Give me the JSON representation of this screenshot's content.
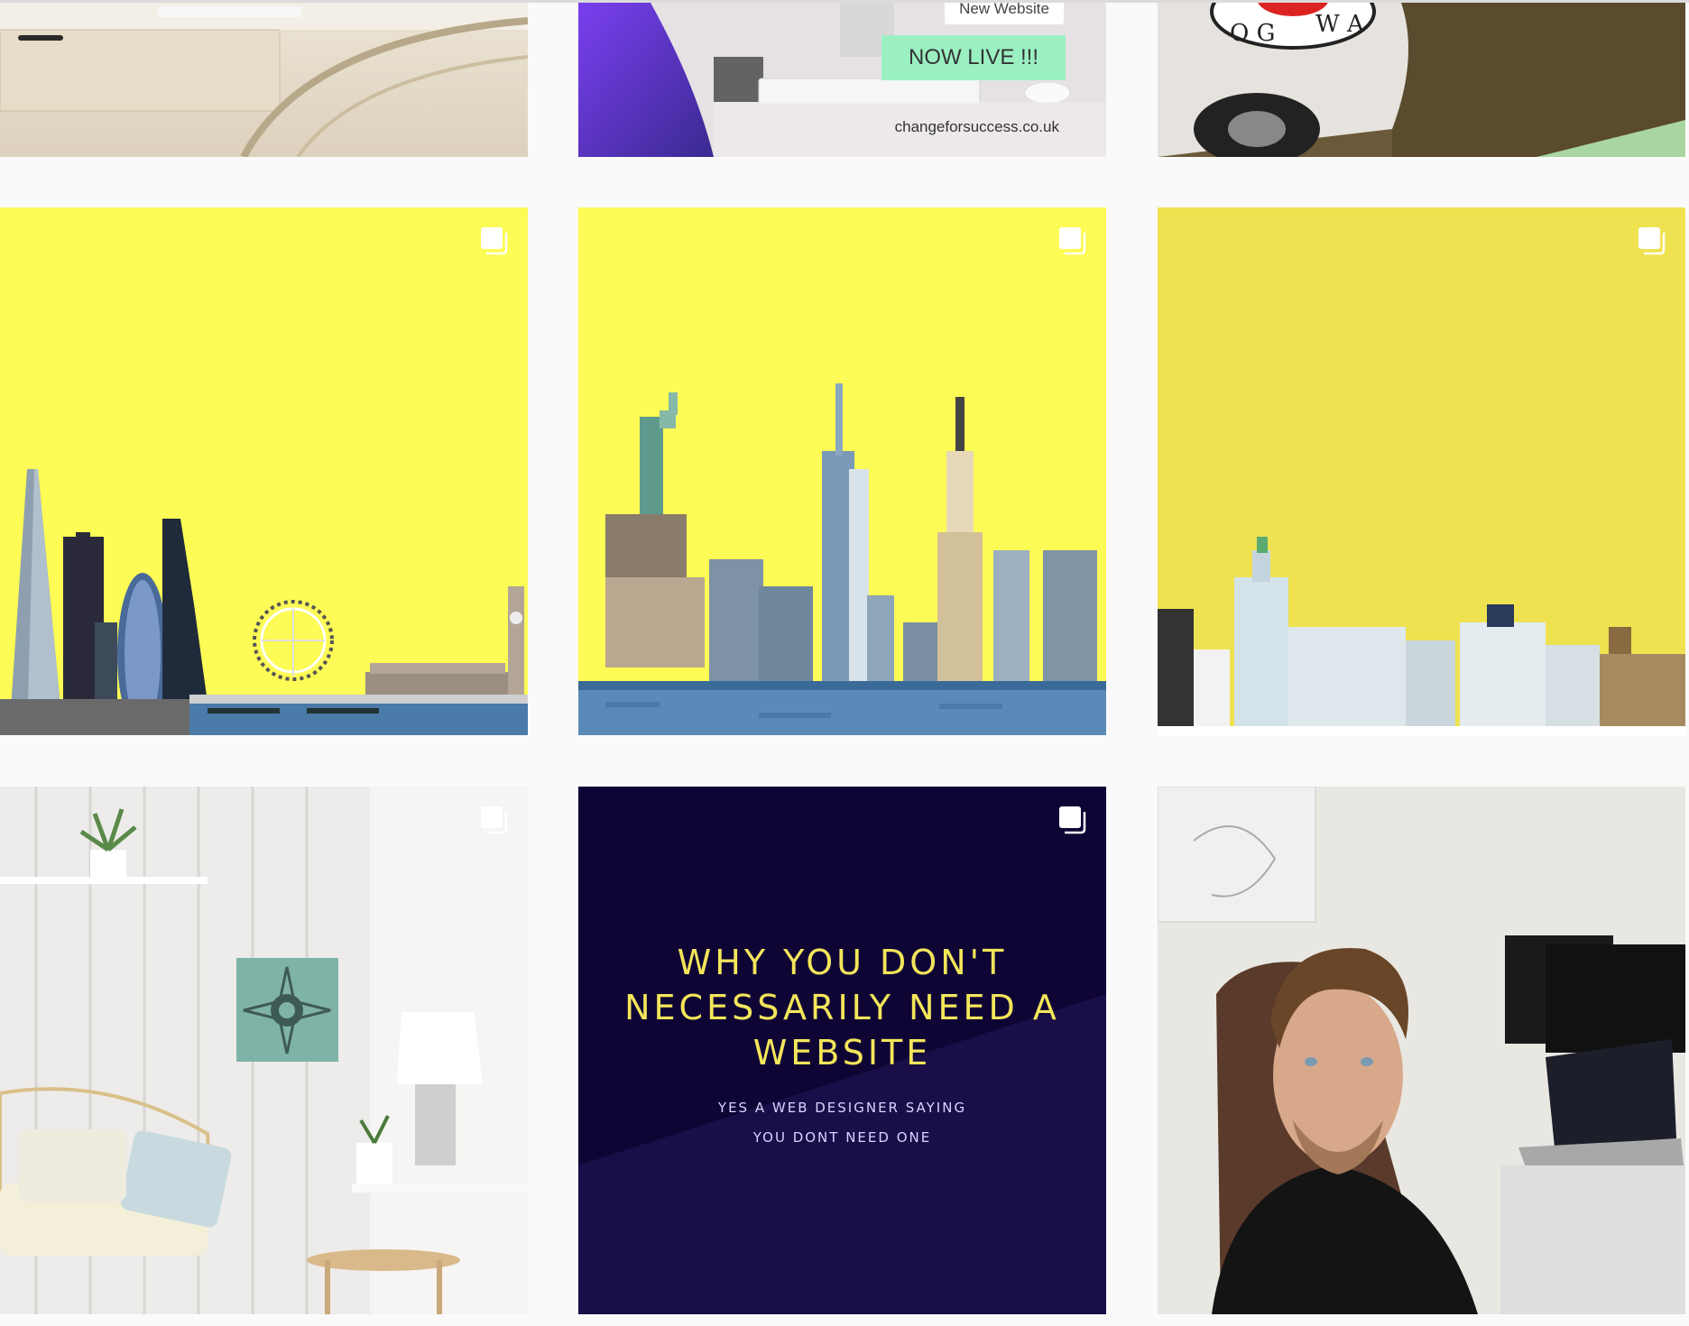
{
  "grid": {
    "posts": [
      {
        "id": "post-1",
        "alt": "desk"
      },
      {
        "id": "post-2",
        "new_website_label": "New Website",
        "badge_text": "NOW LIVE !!!",
        "domain_text": "changeforsuccess.co.uk"
      },
      {
        "id": "post-3",
        "alt": "dog walking van"
      },
      {
        "id": "post-4",
        "alt": "london skyline",
        "multi": true
      },
      {
        "id": "post-5",
        "alt": "new york skyline",
        "multi": true
      },
      {
        "id": "post-6",
        "alt": "liverpool skyline",
        "multi": true
      },
      {
        "id": "post-7",
        "alt": "living room art",
        "multi": true
      },
      {
        "id": "post-8",
        "headline": "WHY YOU DON'T NECESSARILY NEED A WEBSITE",
        "subline_1": "YES A WEB DESIGNER SAYING",
        "subline_2": "YOU DONT NEED ONE",
        "multi": true
      },
      {
        "id": "post-9",
        "alt": "selfie portrait"
      }
    ]
  },
  "icons": {
    "multi": "carousel-icon"
  },
  "colors": {
    "page_bg": "#fafafa",
    "yellow": "#fdfb55",
    "navy": "#1a0e48",
    "mint": "#9bf0c2"
  }
}
